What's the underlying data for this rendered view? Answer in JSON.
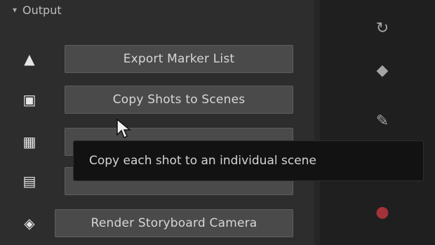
{
  "section": {
    "title": "Output",
    "chevron": "▾"
  },
  "rows": [
    {
      "icon": "triangle-icon",
      "glyph": "▲",
      "label": "Export Marker List"
    },
    {
      "icon": "clipboard-icon",
      "glyph": "▣",
      "label": "Copy Shots to Scenes"
    },
    {
      "icon": "grid-icon",
      "glyph": "▦",
      "label": ""
    },
    {
      "icon": "slides-icon",
      "glyph": "▤",
      "label": ""
    },
    {
      "icon": "render-icon",
      "glyph": "◈",
      "label": "Render Storyboard Camera"
    }
  ],
  "tooltip": {
    "text": "Copy each shot to an individual scene"
  },
  "tools": [
    {
      "icon": "rotate-icon",
      "glyph": "↻"
    },
    {
      "icon": "diamond-icon",
      "glyph": "◆"
    },
    {
      "icon": "pencil-icon",
      "glyph": "✎"
    },
    {
      "icon": "record-icon",
      "glyph": "●",
      "color": "#a3323a"
    }
  ]
}
